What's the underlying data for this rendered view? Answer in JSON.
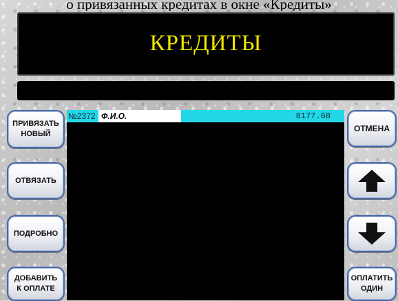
{
  "caption": "о привязанных кредитах в окне «Кредиты»",
  "title": "КРЕДИТЫ",
  "status_text": "",
  "left_buttons": [
    {
      "label_line1": "ПРИВЯЗАТЬ",
      "label_line2": "НОВЫЙ"
    },
    {
      "label_line1": "ОТВЯЗАТЬ",
      "label_line2": ""
    },
    {
      "label_line1": "ПОДРОБНО",
      "label_line2": ""
    },
    {
      "label_line1": "ДОБАВИТЬ",
      "label_line2": "К ОПЛАТЕ"
    }
  ],
  "right_buttons": {
    "cancel": "ОТМЕНА",
    "pay_line1": "ОПЛАТИТЬ",
    "pay_line2": "ОДИН"
  },
  "icons": {
    "up": "arrow-up-icon",
    "down": "arrow-down-icon"
  },
  "credits": [
    {
      "number": "№2372",
      "name": "Ф.И.О.",
      "sum": "8177.68"
    }
  ],
  "colors": {
    "title": "#f1e600",
    "row_highlight": "#23d8e6",
    "button_border": "#4a6aa8"
  }
}
